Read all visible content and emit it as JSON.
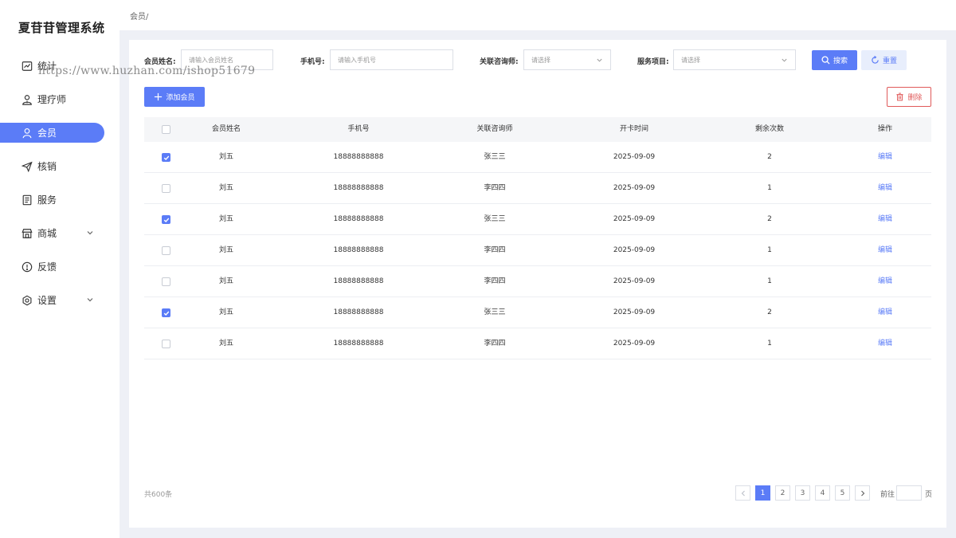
{
  "app": {
    "title": "夏苷苷管理系统",
    "watermark": "https://www.huzhan.com/ishop51679"
  },
  "sidebar": {
    "items": [
      {
        "label": "统计",
        "icon": "chart-line-icon"
      },
      {
        "label": "理疗师",
        "icon": "user-tie-icon"
      },
      {
        "label": "会员",
        "icon": "user-icon",
        "active": true
      },
      {
        "label": "核销",
        "icon": "paper-plane-icon"
      },
      {
        "label": "服务",
        "icon": "document-icon"
      },
      {
        "label": "商城",
        "icon": "store-icon",
        "expandable": true
      },
      {
        "label": "反馈",
        "icon": "exclamation-circle-icon"
      },
      {
        "label": "设置",
        "icon": "gear-icon",
        "expandable": true
      }
    ]
  },
  "breadcrumb": "会员/",
  "filters": {
    "name": {
      "label": "会员姓名:",
      "placeholder": "请输入会员姓名"
    },
    "phone": {
      "label": "手机号:",
      "placeholder": "请输入手机号"
    },
    "consultant": {
      "label": "关联咨询师:",
      "placeholder": "请选择"
    },
    "service": {
      "label": "服务项目:",
      "placeholder": "请选择"
    }
  },
  "buttons": {
    "search": "搜索",
    "reset": "重置",
    "add": "添加会员",
    "delete": "删除"
  },
  "table": {
    "headers": [
      "会员姓名",
      "手机号",
      "关联咨询师",
      "开卡时间",
      "剩余次数",
      "操作"
    ],
    "rows": [
      {
        "checked": true,
        "name": "刘五",
        "phone": "18888888888",
        "consultant": "张三三",
        "date": "2025-09-09",
        "remaining": "2",
        "action": "编辑"
      },
      {
        "checked": false,
        "name": "刘五",
        "phone": "18888888888",
        "consultant": "李四四",
        "date": "2025-09-09",
        "remaining": "1",
        "action": "编辑"
      },
      {
        "checked": true,
        "name": "刘五",
        "phone": "18888888888",
        "consultant": "张三三",
        "date": "2025-09-09",
        "remaining": "2",
        "action": "编辑"
      },
      {
        "checked": false,
        "name": "刘五",
        "phone": "18888888888",
        "consultant": "李四四",
        "date": "2025-09-09",
        "remaining": "1",
        "action": "编辑"
      },
      {
        "checked": false,
        "name": "刘五",
        "phone": "18888888888",
        "consultant": "李四四",
        "date": "2025-09-09",
        "remaining": "1",
        "action": "编辑"
      },
      {
        "checked": true,
        "name": "刘五",
        "phone": "18888888888",
        "consultant": "张三三",
        "date": "2025-09-09",
        "remaining": "2",
        "action": "编辑"
      },
      {
        "checked": false,
        "name": "刘五",
        "phone": "18888888888",
        "consultant": "李四四",
        "date": "2025-09-09",
        "remaining": "1",
        "action": "编辑"
      }
    ]
  },
  "pagination": {
    "total": "共600条",
    "pages": [
      "1",
      "2",
      "3",
      "4",
      "5"
    ],
    "current": "1",
    "goto_label": "前往",
    "goto_unit": "页"
  },
  "colors": {
    "primary": "#5b7cf7",
    "danger": "#e05a5a",
    "background": "#eef0f6"
  }
}
